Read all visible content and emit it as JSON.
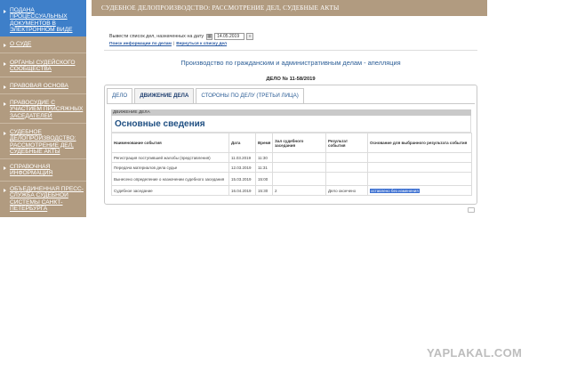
{
  "sidebar": {
    "items": [
      {
        "label": "ПОДАНА ПРОЦЕССУАЛЬНЫХ ДОКУМЕНТОВ В ЭЛЕКТРОННОМ ВИДЕ"
      },
      {
        "label": "О СУДЕ"
      },
      {
        "label": "ОРГАНЫ СУДЕЙСКОГО СООБЩЕСТВА"
      },
      {
        "label": "ПРАВОВАЯ ОСНОВА"
      },
      {
        "label": "ПРАВОСУДИЕ С УЧАСТИЕМ ПРИСЯЖНЫХ ЗАСЕДАТЕЛЕЙ"
      },
      {
        "label": "СУДЕБНОЕ ДЕЛОПРОИЗВОДСТВО: РАССМОТРЕНИЕ ДЕЛ, СУДЕБНЫЕ АКТЫ"
      },
      {
        "label": "СПРАВОЧНАЯ ИНФОРМАЦИЯ"
      },
      {
        "label": "ОБЪЕДИНЕННАЯ ПРЕСС-СЛУЖБА СУДЕБНОЙ СИСТЕМЫ САНКТ-ПЕТЕРБУРГА"
      }
    ]
  },
  "header": {
    "title": "СУДЕБНОЕ ДЕЛОПРОИЗВОДСТВО: РАССМОТРЕНИЕ ДЕЛ, СУДЕБНЫЕ АКТЫ"
  },
  "date_filter": {
    "label": "Вывести список дел, назначенных на дату",
    "value": "14.05.2019",
    "go": "»"
  },
  "links": {
    "search": "Поиск информации по делам",
    "sep": "|",
    "back": "Вернуться к списку дел"
  },
  "section_title": "Производство по гражданским и административным делам - апелляция",
  "case_number": "ДЕЛО № 11-58/2019",
  "tabs": [
    {
      "label": "ДЕЛО"
    },
    {
      "label": "ДВИЖЕНИЕ ДЕЛА"
    },
    {
      "label": "СТОРОНЫ ПО ДЕЛУ (ТРЕТЬИ ЛИЦА)"
    }
  ],
  "group_label": "ДВИЖЕНИЕ ДЕЛА",
  "group_heading": "Основные сведения",
  "table": {
    "headers": [
      "Наименование события",
      "Дата",
      "Время",
      "Зал судебного заседания",
      "Результат события",
      "Основание для выбранного результата события"
    ],
    "rows": [
      [
        "Регистрация поступившей жалобы (представления)",
        "11.03.2019",
        "11:30",
        "",
        "",
        ""
      ],
      [
        "Передача материалов дела судье",
        "12.03.2019",
        "11:31",
        "",
        "",
        ""
      ],
      [
        "Вынесено определение о назначении судебного заседания",
        "15.03.2019",
        "15:00",
        "",
        "",
        ""
      ],
      [
        "Судебное заседание",
        "16.04.2019",
        "15:30",
        "2",
        "Дело окончено",
        "оставлено без изменения"
      ]
    ]
  },
  "watermark": "YAPLAKAL.COM",
  "colors": {
    "sidebar": "#b19b80",
    "active": "#3e7fc9",
    "link": "#2a5aa3",
    "title": "#2b5d96"
  }
}
